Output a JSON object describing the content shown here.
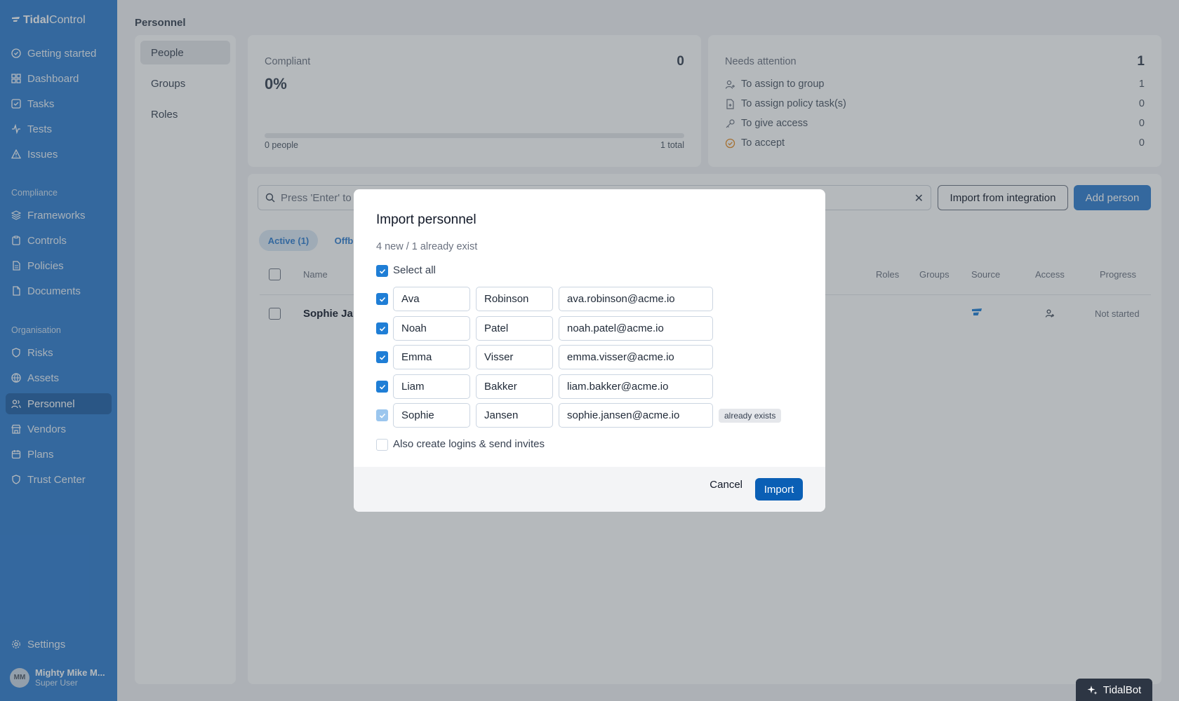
{
  "app": {
    "logo_a": "Tidal",
    "logo_b": "Control"
  },
  "sidebar": {
    "items": [
      {
        "label": "Getting started",
        "icon": "check-circle-icon"
      },
      {
        "label": "Dashboard",
        "icon": "grid-icon"
      },
      {
        "label": "Tasks",
        "icon": "checkbox-icon"
      },
      {
        "label": "Tests",
        "icon": "pulse-icon"
      },
      {
        "label": "Issues",
        "icon": "warning-icon"
      }
    ],
    "compliance_label": "Compliance",
    "compliance_items": [
      {
        "label": "Frameworks",
        "icon": "layers-icon"
      },
      {
        "label": "Controls",
        "icon": "clipboard-icon"
      },
      {
        "label": "Policies",
        "icon": "file-icon"
      },
      {
        "label": "Documents",
        "icon": "document-icon"
      }
    ],
    "organisation_label": "Organisation",
    "organisation_items": [
      {
        "label": "Risks",
        "icon": "shield-icon"
      },
      {
        "label": "Assets",
        "icon": "globe-icon"
      },
      {
        "label": "Personnel",
        "icon": "users-icon",
        "active": true
      },
      {
        "label": "Vendors",
        "icon": "store-icon"
      },
      {
        "label": "Plans",
        "icon": "calendar-icon"
      },
      {
        "label": "Trust Center",
        "icon": "shield-check-icon"
      }
    ],
    "settings_label": "Settings",
    "user": {
      "initials": "MM",
      "name": "Mighty Mike M...",
      "role": "Super User"
    }
  },
  "page": {
    "title": "Personnel"
  },
  "subnav": {
    "items": [
      "People",
      "Groups",
      "Roles"
    ]
  },
  "compliant_card": {
    "label": "Compliant",
    "count": "0",
    "percent": "0%",
    "people": "0 people",
    "total": "1 total",
    "progress": 0
  },
  "attention_card": {
    "label": "Needs attention",
    "count": "1",
    "rows": [
      {
        "label": "To assign to group",
        "count": "1"
      },
      {
        "label": "To assign policy task(s)",
        "count": "0"
      },
      {
        "label": "To give access",
        "count": "0"
      },
      {
        "label": "To accept",
        "count": "0"
      }
    ]
  },
  "toolbar": {
    "search_placeholder": "Press 'Enter' to",
    "clear": "✕",
    "import_integration": "Import from integration",
    "add_person": "Add person"
  },
  "tabs": {
    "active": "Active (1)",
    "offboarded": "Offb"
  },
  "table": {
    "headers": {
      "name": "Name",
      "roles": "Roles",
      "groups": "Groups",
      "source": "Source",
      "access": "Access",
      "progress": "Progress"
    },
    "row": {
      "name": "Sophie Jan",
      "progress": "Not started"
    }
  },
  "modal": {
    "title": "Import personnel",
    "subtitle": "4 new / 1 already exist",
    "select_all": "Select all",
    "rows": [
      {
        "first": "Ava",
        "last": "Robinson",
        "email": "ava.robinson@acme.io",
        "checked": true
      },
      {
        "first": "Noah",
        "last": "Patel",
        "email": "noah.patel@acme.io",
        "checked": true
      },
      {
        "first": "Emma",
        "last": "Visser",
        "email": "emma.visser@acme.io",
        "checked": true
      },
      {
        "first": "Liam",
        "last": "Bakker",
        "email": "liam.bakker@acme.io",
        "checked": true
      },
      {
        "first": "Sophie",
        "last": "Jansen",
        "email": "sophie.jansen@acme.io",
        "checked": true,
        "tag": "already exists"
      }
    ],
    "invite_label": "Also create logins & send invites",
    "cancel": "Cancel",
    "import": "Import"
  },
  "tidalbot": "TidalBot",
  "colors": {
    "sidebar": "#2f7dcf",
    "primary": "#0a5fb5",
    "checkbox": "#1f7ed6"
  }
}
